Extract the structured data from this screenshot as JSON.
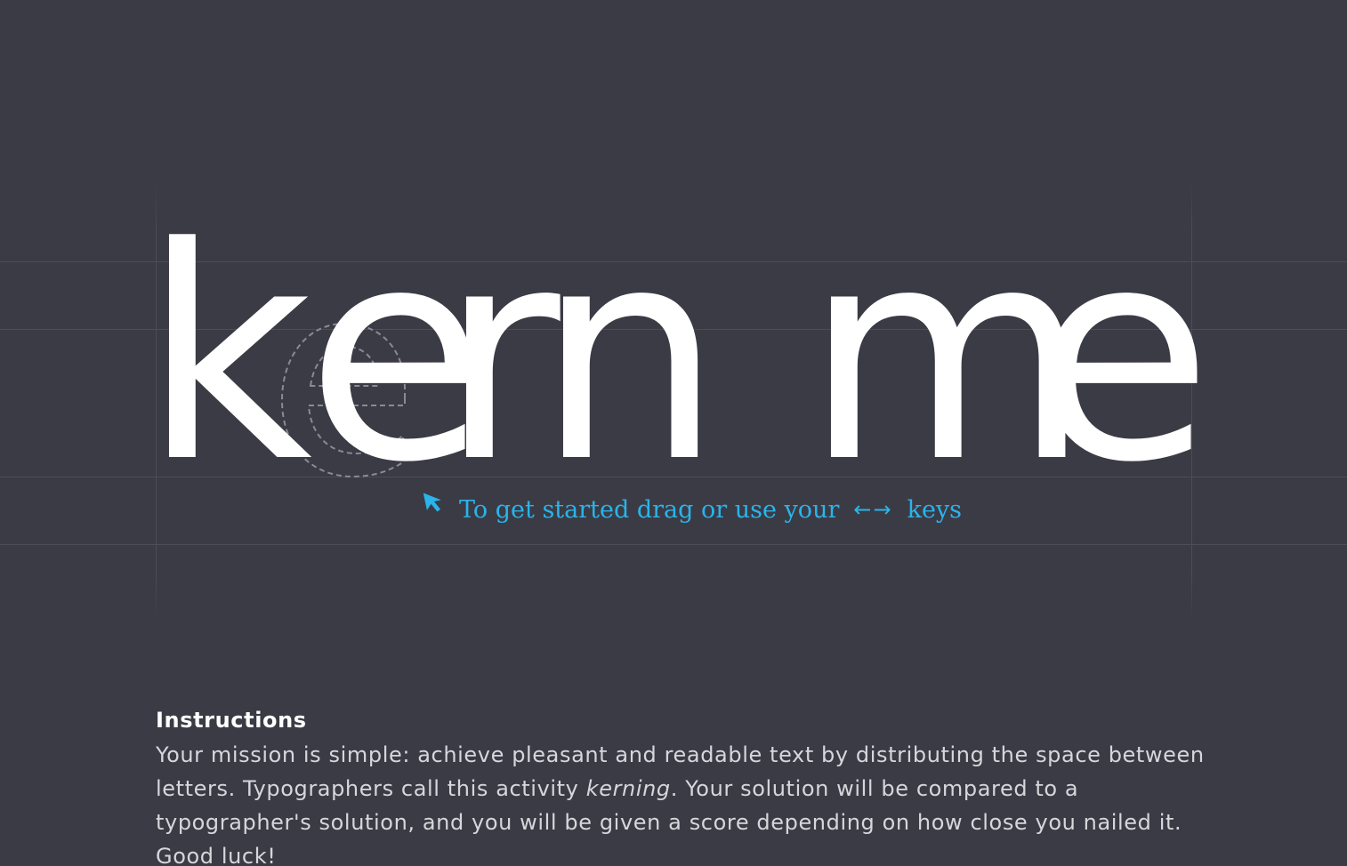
{
  "game": {
    "letters": [
      {
        "char": "k",
        "draggable": false
      },
      {
        "char": "e",
        "draggable": true
      },
      {
        "char": "r",
        "draggable": true
      },
      {
        "char": "n",
        "draggable": true
      },
      {
        "char": "m",
        "draggable": true
      },
      {
        "char": "e",
        "draggable": false
      }
    ],
    "ghost_letter": "e",
    "hint": {
      "text": "To get started drag or use your",
      "arrows": "←→",
      "suffix": "keys",
      "icon": "cursor-arrow-icon"
    }
  },
  "instructions": {
    "title": "Instructions",
    "text_before": "Your mission is simple: achieve pleasant and readable text by distributing the space between letters. Typographers call this activity ",
    "emphasis": "kerning",
    "text_after": ". Your solution will be compared to a typographer's solution, and you will be given a score depending on how close you nailed it. Good luck!"
  },
  "colors": {
    "background": "#3b3b45",
    "guide": "#4d4d58",
    "letter": "#ffffff",
    "accent": "#2ab4ea",
    "text": "#d6d6dc"
  }
}
